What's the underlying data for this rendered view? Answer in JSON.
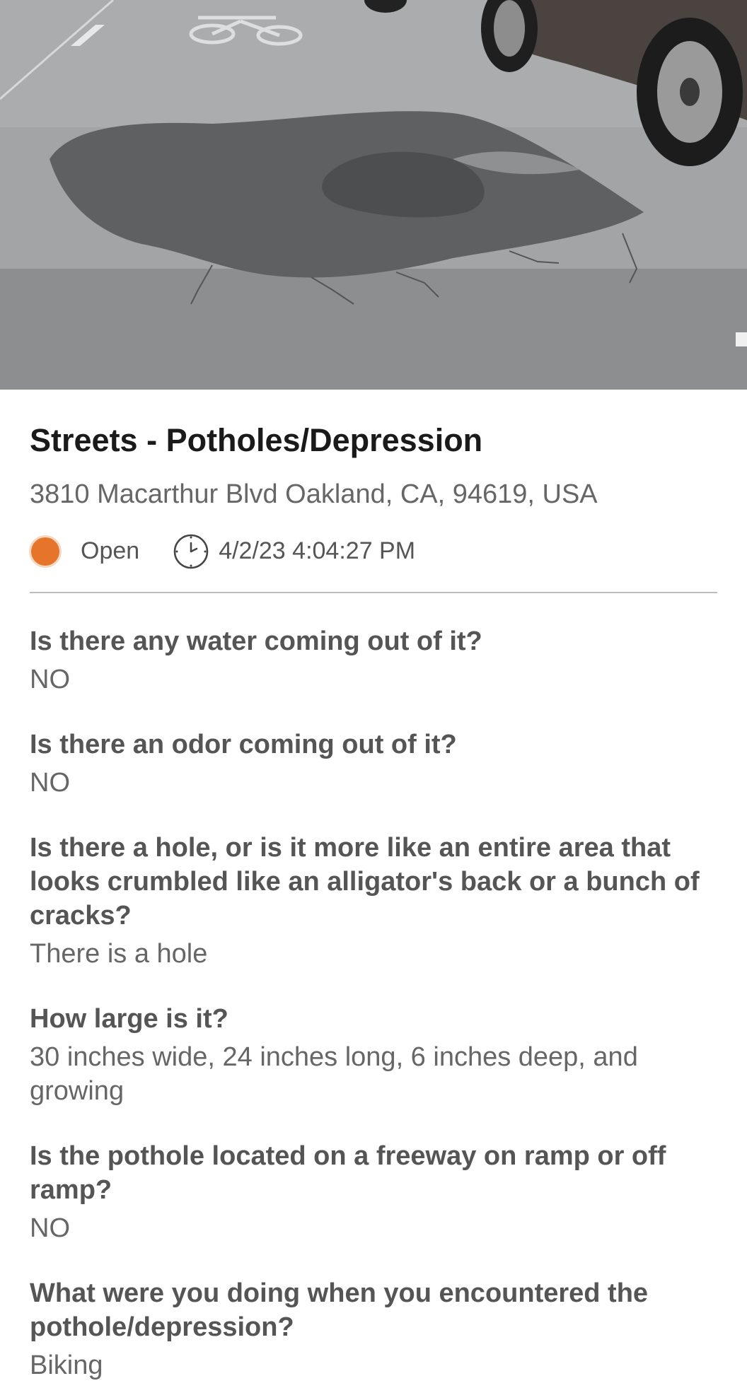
{
  "report": {
    "category": "Streets - Potholes/Depression",
    "address": "3810 Macarthur Blvd Oakland, CA, 94619, USA",
    "status": "Open",
    "status_color": "#e6752b",
    "datetime": "4/2/23 4:04:27 PM"
  },
  "photo": {
    "description_icon": "pothole-photo"
  },
  "questions": [
    {
      "q": "Is there any water coming out of it?",
      "a": "NO"
    },
    {
      "q": "Is there an odor coming out of it?",
      "a": "NO"
    },
    {
      "q": "Is there a hole, or is it more like an entire area that looks crumbled like an alligator's back or a bunch of cracks?",
      "a": "There is a hole"
    },
    {
      "q": "How large is it?",
      "a": "30 inches wide, 24 inches long, 6 inches deep, and growing"
    },
    {
      "q": "Is the pothole located on a freeway on ramp or off ramp?",
      "a": "NO"
    },
    {
      "q": "What were you doing when you encountered the pothole/depression?",
      "a": "Biking"
    }
  ]
}
